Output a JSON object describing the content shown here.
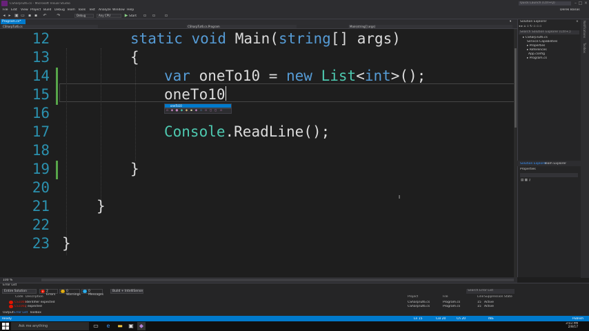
{
  "window": {
    "title": "CSharpTut6.cs - Microsoft Visual Studio",
    "quick_launch": "Quick Launch (Ctrl+Q)",
    "user": "Derek Banas"
  },
  "menu": [
    "File",
    "Edit",
    "View",
    "Project",
    "Build",
    "Debug",
    "Team",
    "Tools",
    "Test",
    "Analyze",
    "Window",
    "Help"
  ],
  "toolbar": {
    "config": "Debug",
    "platform": "Any CPU",
    "start_label": "Start"
  },
  "tabs": [
    {
      "label": "Program.cs*"
    }
  ],
  "navbar": {
    "project": "CSharpTut6.cs",
    "class": "CSharpTut6.cs.Program",
    "member": "Main(string[] args)"
  },
  "editor": {
    "line_numbers": [
      "12",
      "13",
      "14",
      "15",
      "16",
      "17",
      "18",
      "19",
      "20",
      "21",
      "22",
      "23"
    ],
    "lines": {
      "l12_kw": "static void ",
      "l12_name": "Main(",
      "l12_kw2": "string",
      "l12_rest": "[] args)",
      "l13": "{",
      "l14_kw": "var",
      "l14_mid": " oneTo10 = ",
      "l14_kw2": "new",
      "l14_sp": " ",
      "l14_cls": "List",
      "l14_lt": "<",
      "l14_kw3": "int",
      "l14_rest": ">();",
      "l15": "oneTo10",
      "l17_cls": "Console",
      "l17_rest": ".ReadLine();",
      "l19": "}",
      "l21": "}",
      "l23": "}"
    }
  },
  "intellisense": {
    "selected": "oneTo10"
  },
  "solution_explorer": {
    "title": "Solution Explorer",
    "search_placeholder": "Search Solution Explorer (Ctrl+;)",
    "items": [
      {
        "label": "CSharpTut6.cs"
      },
      {
        "label": "Service Capabilities"
      },
      {
        "label": "Properties"
      },
      {
        "label": "References"
      },
      {
        "label": "App.config"
      },
      {
        "label": "Program.cs"
      }
    ],
    "tab_active": "Solution Explorer",
    "tab_other": "Team Explorer"
  },
  "properties": {
    "title": "Properties"
  },
  "side_tabs": [
    "Notifications",
    "Toolbox"
  ],
  "zoom": "100 %",
  "error_list": {
    "title": "Error List",
    "scope": "Entire Solution",
    "errors_btn": "2 Errors",
    "warnings_btn": "0 Warnings",
    "messages_btn": "0 Messages",
    "filter": "Build + IntelliSense",
    "search_placeholder": "Search Error List",
    "headers": {
      "code": "Code",
      "description": "Description",
      "project": "Project",
      "file": "File",
      "line": "Line",
      "suppression": "Suppression State"
    },
    "rows": [
      {
        "code": "CS1001",
        "description": "Identifier expected",
        "project": "CSharpTut6.cs",
        "file": "Program.cs",
        "line": "15",
        "suppression": "Active"
      },
      {
        "code": "CS1002",
        "description": "; expected",
        "project": "CSharpTut6.cs",
        "file": "Program.cs",
        "line": "15",
        "suppression": "Active"
      }
    ]
  },
  "bottom_tabs": [
    "Output",
    "Error List",
    "Toolbox"
  ],
  "status": {
    "left": "Ready",
    "ln": "Ln 15",
    "col": "Col 20",
    "ch": "Ch 20",
    "ins": "INS",
    "publish": "Publish"
  },
  "taskbar": {
    "search": "Ask me anything",
    "time": "3:03 PM",
    "date": "2/8/17"
  },
  "colors": {
    "accent": "#007acc",
    "keyword": "#569cd6",
    "type": "#4ec9b0",
    "line_number": "#2b91af",
    "error": "#e51400"
  }
}
